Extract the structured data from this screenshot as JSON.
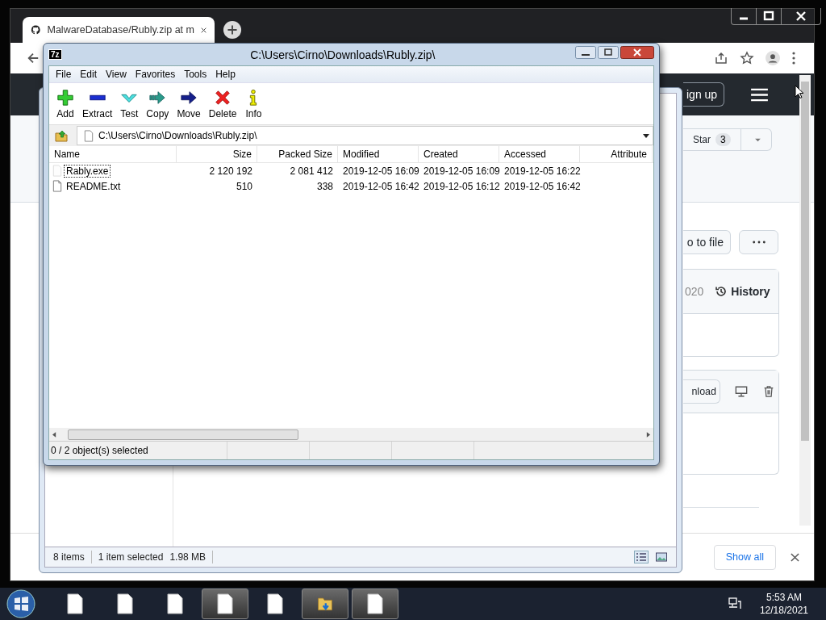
{
  "browser": {
    "tab_title": "MalwareDatabase/Rubly.zip at m",
    "page": {
      "signup_button": "ign up",
      "star_button": {
        "label": "Star",
        "count": "3"
      },
      "goto_button": "o to file",
      "commit_date": "020",
      "history_button": "History",
      "download_button": "nload"
    },
    "download_bar": {
      "show_all": "Show all"
    }
  },
  "explorer": {
    "status_items": "8 items",
    "status_selected": "1 item selected",
    "status_size": "1.98 MB"
  },
  "archive_window": {
    "app_icon": "7z",
    "title": "C:\\Users\\Cirno\\Downloads\\Rubly.zip\\",
    "menu": [
      "File",
      "Edit",
      "View",
      "Favorites",
      "Tools",
      "Help"
    ],
    "toolbar": [
      {
        "label": "Add",
        "kind": "add"
      },
      {
        "label": "Extract",
        "kind": "extract"
      },
      {
        "label": "Test",
        "kind": "test"
      },
      {
        "label": "Copy",
        "kind": "copy"
      },
      {
        "label": "Move",
        "kind": "move"
      },
      {
        "label": "Delete",
        "kind": "delete"
      },
      {
        "label": "Info",
        "kind": "info"
      }
    ],
    "path": "C:\\Users\\Cirno\\Downloads\\Rubly.zip\\",
    "columns": [
      "Name",
      "Size",
      "Packed Size",
      "Modified",
      "Created",
      "Accessed",
      "Attribute"
    ],
    "rows": [
      {
        "kind": "exe",
        "focused": true,
        "cells": [
          "Rably.exe",
          "2 120 192",
          "2 081 412",
          "2019-12-05 16:09",
          "2019-12-05 16:09",
          "2019-12-05 16:22"
        ]
      },
      {
        "kind": "text",
        "focused": false,
        "cells": [
          "README.txt",
          "510",
          "338",
          "2019-12-05 16:42",
          "2019-12-05 16:12",
          "2019-12-05 16:42"
        ]
      }
    ],
    "status": "0 / 2 object(s) selected"
  },
  "taskbar": {
    "items": [
      {
        "kind": "document",
        "highlighted": false
      },
      {
        "kind": "document",
        "highlighted": false
      },
      {
        "kind": "document",
        "highlighted": false
      },
      {
        "kind": "document",
        "highlighted": true
      },
      {
        "kind": "document",
        "highlighted": false
      },
      {
        "kind": "folder",
        "highlighted": true
      },
      {
        "kind": "document",
        "highlighted": true
      }
    ],
    "time": "5:53 AM",
    "date": "12/18/2021"
  }
}
